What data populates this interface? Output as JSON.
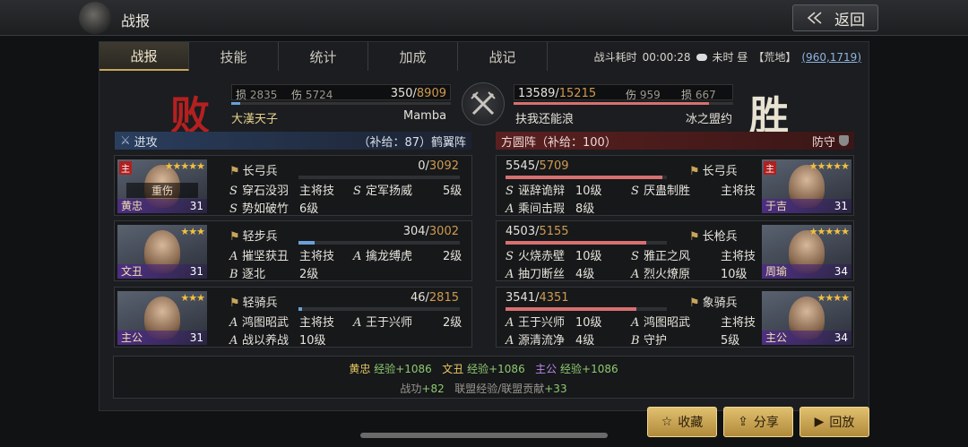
{
  "window": {
    "title": "战报",
    "back_label": "返回"
  },
  "tabs": [
    "战报",
    "技能",
    "统计",
    "加成",
    "战记"
  ],
  "battle_info": {
    "duration_label": "战斗耗时",
    "duration": "00:00:28",
    "weather": "未时 昼",
    "terrain": "【荒地】",
    "coords": "(960,1719)"
  },
  "attacker": {
    "result": "败",
    "loss_label": "损",
    "loss": "2835",
    "dmg_label": "伤",
    "dmg": "5724",
    "hp": "350",
    "hp_max": "8909",
    "hp_frac": 0.04,
    "player": "大漢天子",
    "team": "Mamba",
    "side_label": "进攻",
    "supply": "（补给：87）鹤翼阵"
  },
  "defender": {
    "result": "胜",
    "loss_label": "损",
    "loss": "667",
    "dmg_label": "伤",
    "dmg": "959",
    "hp": "13589",
    "hp_max": "15215",
    "hp_frac": 0.89,
    "player": "扶我还能浪",
    "team": "冰之盟约",
    "side_label": "方圆阵（补给：100）",
    "stance": "防守"
  },
  "left_units": [
    {
      "name": "黄忠",
      "level": "31",
      "lord": "主",
      "stars": "★★★★★",
      "hurt": "重伤",
      "troop_type": "长弓兵",
      "troops": "0",
      "troops_max": "3092",
      "frac": 0.0,
      "skills": [
        {
          "g": "S",
          "n": "穿石没羽",
          "v": "主将技"
        },
        {
          "g": "S",
          "n": "定军扬威",
          "v": "5级"
        },
        {
          "g": "S",
          "n": "势如破竹",
          "v": "6级"
        }
      ]
    },
    {
      "name": "文丑",
      "level": "31",
      "stars": "★★★",
      "troop_type": "轻步兵",
      "troops": "304",
      "troops_max": "3002",
      "frac": 0.1,
      "skills": [
        {
          "g": "A",
          "n": "摧坚获丑",
          "v": "主将技"
        },
        {
          "g": "A",
          "n": "擒龙缚虎",
          "v": "2级"
        },
        {
          "g": "B",
          "n": "逐北",
          "v": "2级"
        }
      ]
    },
    {
      "name": "主公",
      "level": "31",
      "stars": "★★★",
      "troop_type": "轻骑兵",
      "troops": "46",
      "troops_max": "2815",
      "frac": 0.02,
      "skills": [
        {
          "g": "A",
          "n": "鸿图昭武",
          "v": "主将技"
        },
        {
          "g": "A",
          "n": "王于兴师",
          "v": "2级"
        },
        {
          "g": "A",
          "n": "战以养战",
          "v": "10级"
        }
      ]
    }
  ],
  "right_units": [
    {
      "name": "于吉",
      "level": "31",
      "lord": "主",
      "stars": "★★★★★",
      "troop_type": "长弓兵",
      "troops": "5545",
      "troops_max": "5709",
      "frac": 0.97,
      "skills": [
        {
          "g": "S",
          "n": "诬辞诡辩",
          "v": "10级"
        },
        {
          "g": "S",
          "n": "厌蛊制胜",
          "v": "主将技"
        },
        {
          "g": "A",
          "n": "乘间击瑕",
          "v": "8级"
        }
      ]
    },
    {
      "name": "周瑜",
      "level": "34",
      "stars": "★★★★★",
      "troop_type": "长枪兵",
      "troops": "4503",
      "troops_max": "5155",
      "frac": 0.87,
      "skills": [
        {
          "g": "S",
          "n": "火烧赤壁",
          "v": "10级"
        },
        {
          "g": "S",
          "n": "雅正之风",
          "v": "主将技"
        },
        {
          "g": "A",
          "n": "抽刀断丝",
          "v": "4级"
        },
        {
          "g": "A",
          "n": "烈火燎原",
          "v": "10级"
        }
      ]
    },
    {
      "name": "主公",
      "level": "34",
      "stars": "★★★★",
      "troop_type": "象骑兵",
      "troops": "3541",
      "troops_max": "4351",
      "frac": 0.81,
      "skills": [
        {
          "g": "A",
          "n": "王于兴师",
          "v": "10级"
        },
        {
          "g": "A",
          "n": "鸿图昭武",
          "v": "主将技"
        },
        {
          "g": "A",
          "n": "源清流净",
          "v": "4级"
        },
        {
          "g": "B",
          "n": "守护",
          "v": "5级"
        }
      ]
    }
  ],
  "summary": {
    "exp1_name": "黄忠",
    "exp1": "经验+1086",
    "exp2_name": "文丑",
    "exp2": "经验+1086",
    "exp3_name": "主公",
    "exp3": "经验+1086",
    "merit_label": "战功",
    "merit": "+82",
    "league_label": "联盟经验/联盟贡献",
    "league": "+33"
  },
  "buttons": {
    "favorite": "收藏",
    "share": "分享",
    "replay": "回放"
  },
  "colors": {
    "accent_gold": "#c9a55a",
    "lose_red": "#b42020",
    "ally_blue": "#6aa0d8",
    "enemy_red": "#d87070"
  }
}
